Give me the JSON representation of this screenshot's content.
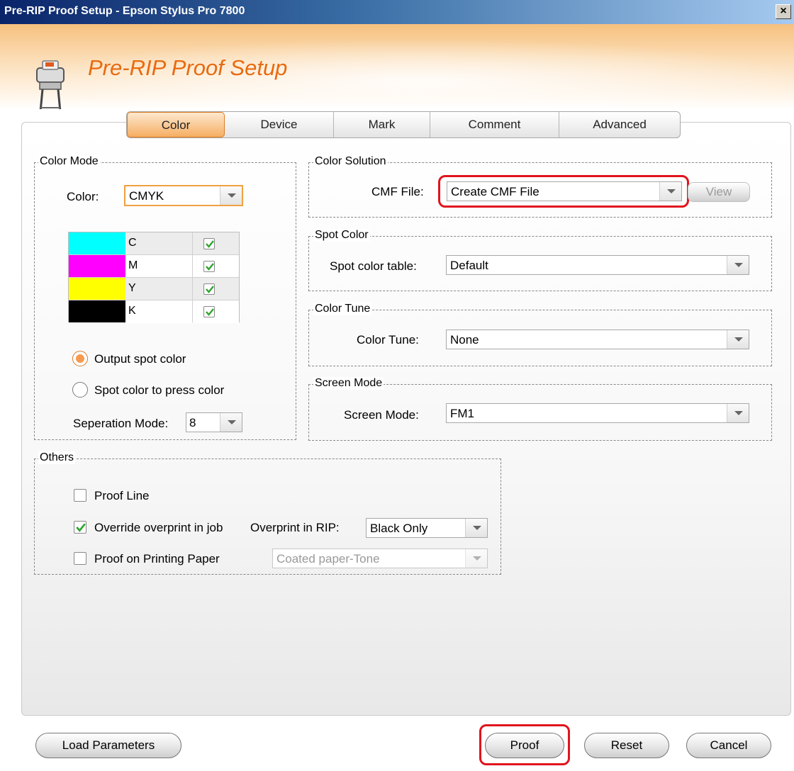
{
  "window": {
    "title": "Pre-RIP Proof Setup - Epson Stylus Pro 7800",
    "close_label": "×"
  },
  "header": {
    "title": "Pre-RIP Proof Setup",
    "icon": "printer-icon"
  },
  "tabs": [
    {
      "label": "Color",
      "active": true
    },
    {
      "label": "Device",
      "active": false
    },
    {
      "label": "Mark",
      "active": false
    },
    {
      "label": "Comment",
      "active": false
    },
    {
      "label": "Advanced",
      "active": false
    }
  ],
  "color_mode": {
    "title": "Color Mode",
    "color_label": "Color:",
    "color_value": "CMYK",
    "channels": [
      {
        "name": "C",
        "color": "#00ffff",
        "checked": true
      },
      {
        "name": "M",
        "color": "#ff00ff",
        "checked": true
      },
      {
        "name": "Y",
        "color": "#ffff00",
        "checked": true
      },
      {
        "name": "K",
        "color": "#000000",
        "checked": true
      }
    ],
    "radio_output_spot": "Output spot color",
    "radio_spot_to_press": "Spot color to press color",
    "separation_label": "Seperation Mode:",
    "separation_value": "8"
  },
  "color_solution": {
    "title": "Color Solution",
    "cmf_label": "CMF File:",
    "cmf_value": "Create CMF File",
    "view_label": "View"
  },
  "spot_color": {
    "title": "Spot Color",
    "table_label": "Spot color table:",
    "table_value": "Default"
  },
  "color_tune": {
    "title": "Color Tune",
    "label": "Color Tune:",
    "value": "None"
  },
  "screen_mode": {
    "title": "Screen Mode",
    "label": "Screen Mode:",
    "value": "FM1"
  },
  "others": {
    "title": "Others",
    "proof_line": {
      "label": "Proof Line",
      "checked": false
    },
    "override": {
      "label": "Override overprint in job",
      "checked": true
    },
    "overprint_rip_label": "Overprint in RIP:",
    "overprint_rip_value": "Black Only",
    "proof_paper": {
      "label": "Proof on Printing Paper",
      "checked": false
    },
    "paper_value": "Coated paper-Tone"
  },
  "footer": {
    "load": "Load Parameters",
    "proof": "Proof",
    "reset": "Reset",
    "cancel": "Cancel"
  },
  "accent_colors": {
    "highlight": "#e0141e",
    "brand": "#e86a10"
  }
}
